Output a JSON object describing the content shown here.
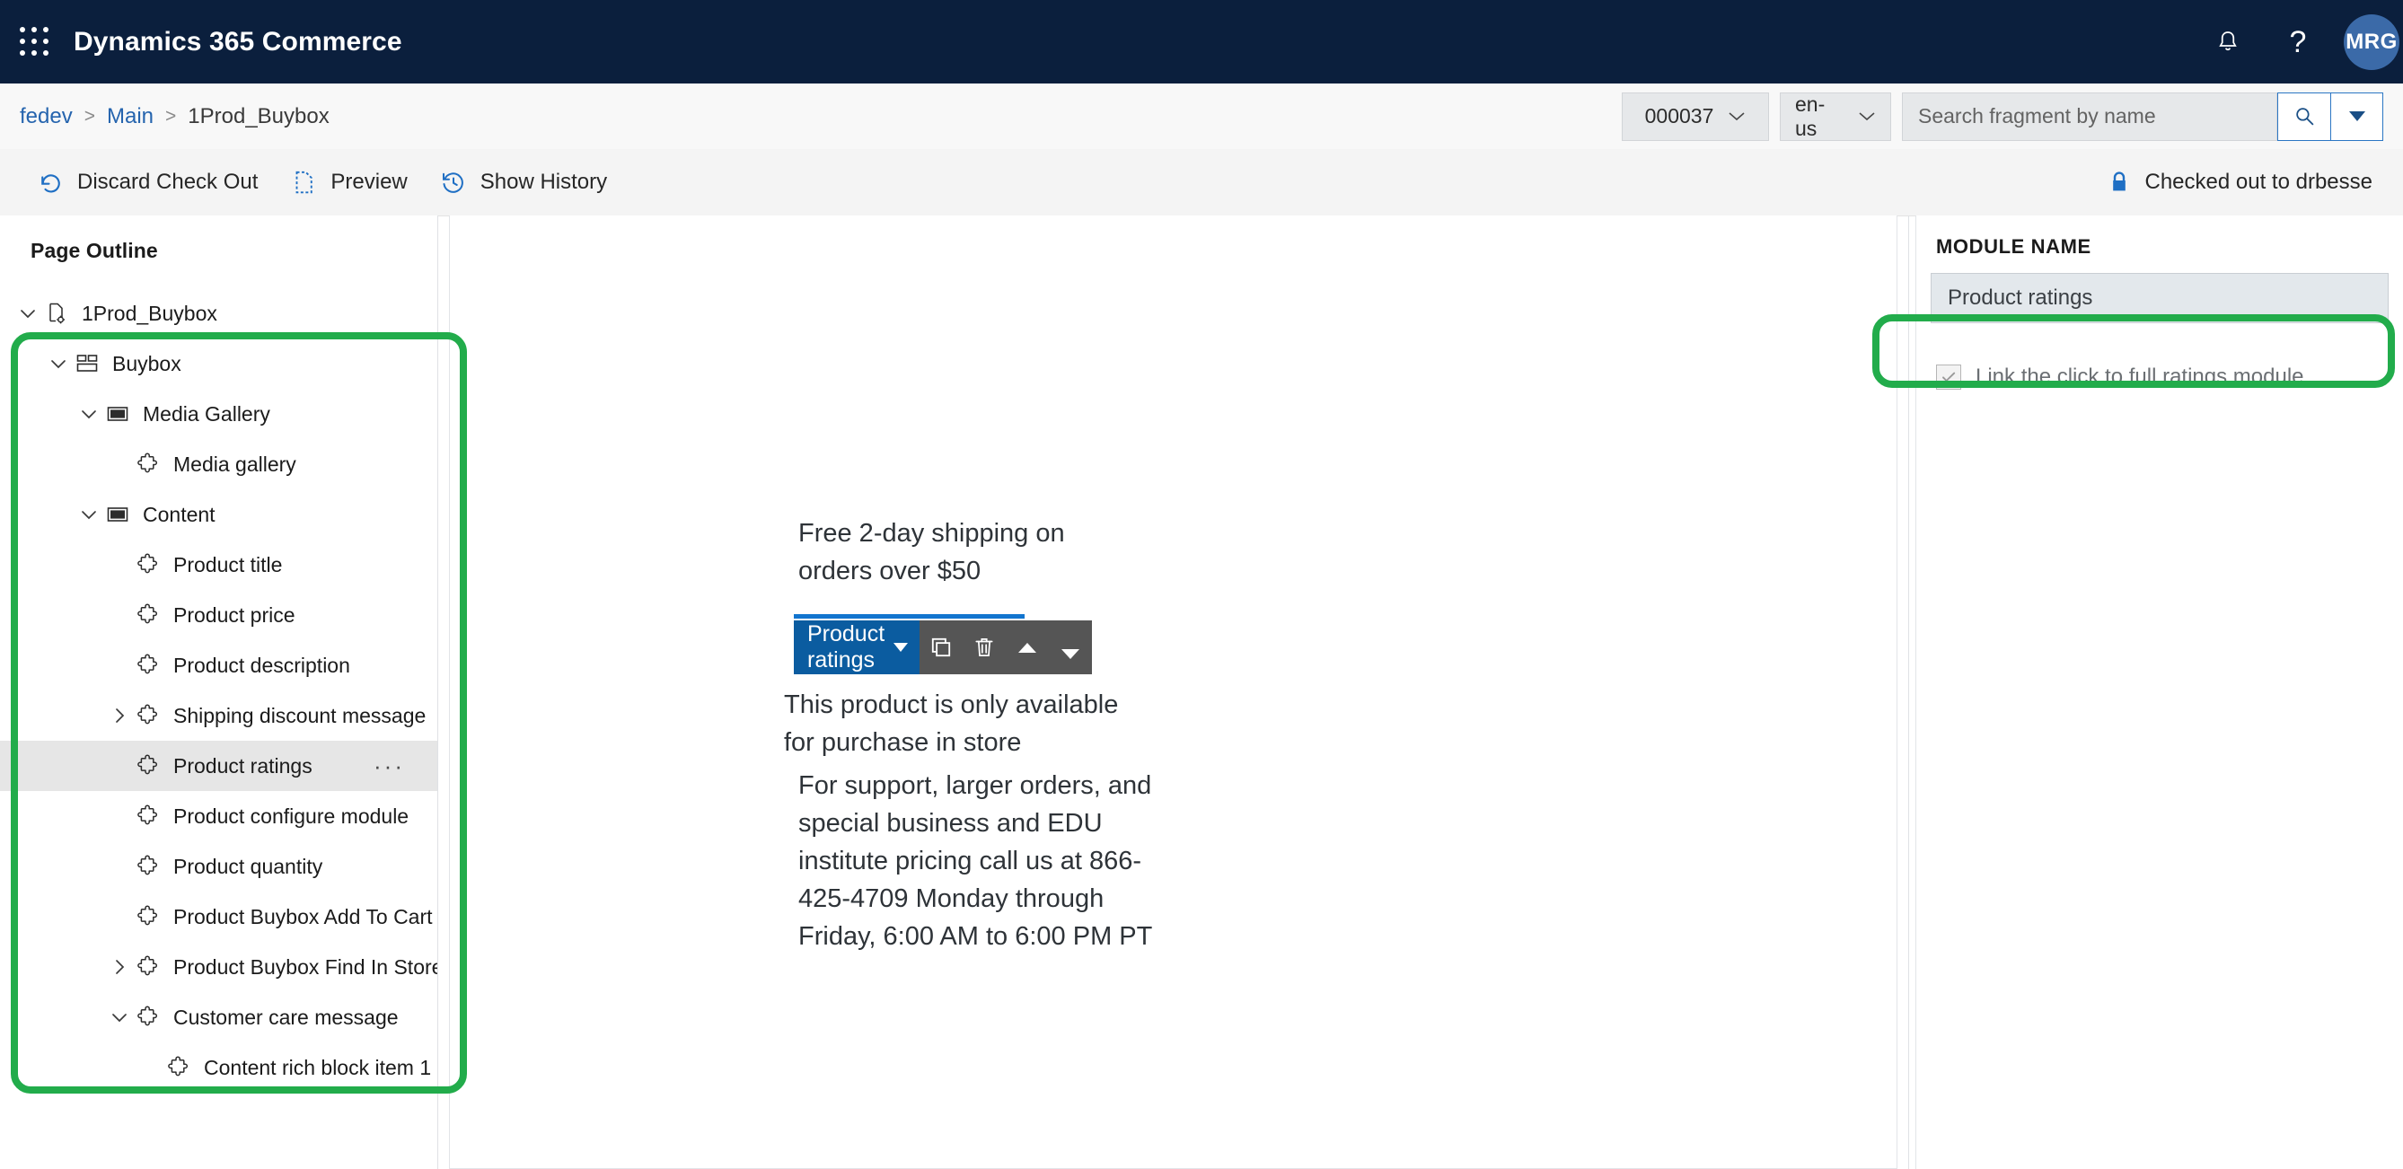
{
  "topnav": {
    "waffle_icon": "app-launcher-icon",
    "title": "Dynamics 365 Commerce",
    "notifications_icon": "bell-icon",
    "help_icon": "question-mark-icon",
    "avatar_initials": "MRG",
    "brand_bg": "#0b1f3d",
    "avatar_bg": "#3b6aa8"
  },
  "breadcrumb": {
    "items": [
      {
        "label": "fedev",
        "link": true
      },
      {
        "label": "Main",
        "link": true
      },
      {
        "label": "1Prod_Buybox",
        "link": false
      }
    ],
    "separator": ">"
  },
  "crumbbar_right": {
    "version_value": "000037",
    "locale_value": "en-us",
    "search_placeholder": "Search fragment by name",
    "search_value": "",
    "search_icon": "search-icon",
    "search_dropdown_icon": "chevron-down-icon"
  },
  "commandbar": {
    "buttons": [
      {
        "label": "Discard Check Out",
        "icon": "undo-icon"
      },
      {
        "label": "Preview",
        "icon": "page-preview-icon"
      },
      {
        "label": "Show History",
        "icon": "history-clock-icon"
      }
    ],
    "status": {
      "label": "Checked out to drbesse",
      "icon": "lock-icon"
    },
    "accent": "#1f6fc4"
  },
  "outline": {
    "header": "Page Outline",
    "nodes": [
      {
        "label": "1Prod_Buybox",
        "indent": 0,
        "chev": "down",
        "icon": "page-settings-icon",
        "selected": false,
        "ellipsis": false
      },
      {
        "label": "Buybox",
        "indent": 1,
        "chev": "down",
        "icon": "layout-grid-icon",
        "selected": false,
        "ellipsis": false
      },
      {
        "label": "Media Gallery",
        "indent": 2,
        "chev": "down",
        "icon": "container-icon",
        "selected": false,
        "ellipsis": false
      },
      {
        "label": "Media gallery",
        "indent": 3,
        "chev": "none",
        "icon": "module-puzzle-icon",
        "selected": false,
        "ellipsis": false
      },
      {
        "label": "Content",
        "indent": 2,
        "chev": "down",
        "icon": "container-icon",
        "selected": false,
        "ellipsis": false
      },
      {
        "label": "Product title",
        "indent": 3,
        "chev": "none",
        "icon": "module-puzzle-icon",
        "selected": false,
        "ellipsis": false
      },
      {
        "label": "Product price",
        "indent": 3,
        "chev": "none",
        "icon": "module-puzzle-icon",
        "selected": false,
        "ellipsis": false
      },
      {
        "label": "Product description",
        "indent": 3,
        "chev": "none",
        "icon": "module-puzzle-icon",
        "selected": false,
        "ellipsis": false
      },
      {
        "label": "Shipping discount message",
        "indent": 3,
        "chev": "right",
        "icon": "module-puzzle-icon",
        "selected": false,
        "ellipsis": false
      },
      {
        "label": "Product ratings",
        "indent": 3,
        "chev": "none",
        "icon": "module-puzzle-icon",
        "selected": true,
        "ellipsis": true
      },
      {
        "label": "Product configure module",
        "indent": 3,
        "chev": "none",
        "icon": "module-puzzle-icon",
        "selected": false,
        "ellipsis": false
      },
      {
        "label": "Product quantity",
        "indent": 3,
        "chev": "none",
        "icon": "module-puzzle-icon",
        "selected": false,
        "ellipsis": false
      },
      {
        "label": "Product Buybox Add To Cart",
        "indent": 3,
        "chev": "none",
        "icon": "module-puzzle-icon",
        "selected": false,
        "ellipsis": false
      },
      {
        "label": "Product Buybox Find In Store",
        "indent": 3,
        "chev": "right",
        "icon": "module-puzzle-icon",
        "selected": false,
        "ellipsis": false
      },
      {
        "label": "Customer care message",
        "indent": 3,
        "chev": "down",
        "icon": "module-puzzle-icon",
        "selected": false,
        "ellipsis": false
      },
      {
        "label": "Content rich block item 1",
        "indent": 4,
        "chev": "none",
        "icon": "module-puzzle-icon",
        "selected": false,
        "ellipsis": false
      }
    ],
    "ellipsis_glyph": "···"
  },
  "canvas": {
    "shipping_text": "Free 2-day shipping on orders over $50",
    "store_text": "This product is only available for purchase in store",
    "care_text": "For support, larger orders, and special business and EDU institute pricing call us at 866-425-4709 Monday through Friday, 6:00 AM to 6:00 PM PT",
    "module_toolbar": {
      "module_label": "Product ratings",
      "dropdown_icon": "chevron-down-icon",
      "copy_icon": "duplicate-icon",
      "delete_icon": "trash-icon",
      "move_up_icon": "caret-up-icon",
      "move_down_icon": "caret-down-icon",
      "accent": "#0b5ca0",
      "tools_bg": "#555555",
      "rule_color": "#1275cf"
    }
  },
  "properties": {
    "header": "MODULE NAME",
    "module_name_value": "Product ratings",
    "checkbox": {
      "label": "Link the click to full ratings module",
      "checked": true,
      "disabled": true,
      "check_glyph": "checkmark-icon"
    }
  },
  "annotations": {
    "color": "#22ac4b",
    "regions": [
      "page-outline-tree",
      "link-click-checkbox"
    ]
  }
}
